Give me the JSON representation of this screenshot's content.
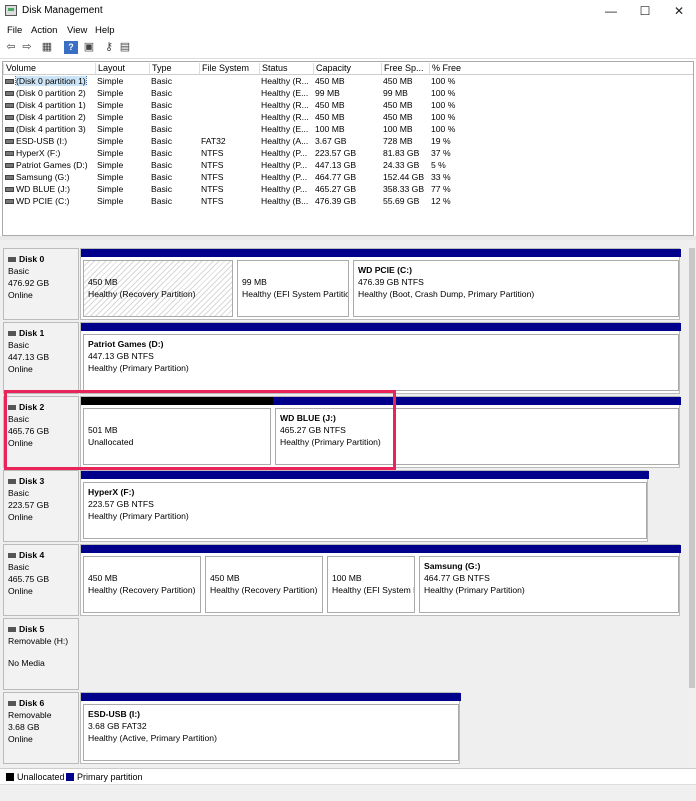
{
  "window": {
    "title": "Disk Management",
    "minimize": "—",
    "maximize": "☐",
    "close": "✕"
  },
  "menu": [
    "File",
    "Action",
    "View",
    "Help"
  ],
  "toolbar_icons": [
    "back-arrow-icon",
    "forward-arrow-icon",
    "properties-icon",
    "help-icon",
    "settings-icon",
    "console-icon"
  ],
  "volume_table": {
    "headers": [
      "Volume",
      "Layout",
      "Type",
      "File System",
      "Status",
      "Capacity",
      "Free Sp...",
      "% Free"
    ],
    "rows": [
      [
        "(Disk 0 partition 1)",
        "Simple",
        "Basic",
        "",
        "Healthy (R...",
        "450 MB",
        "450 MB",
        "100 %"
      ],
      [
        "(Disk 0 partition 2)",
        "Simple",
        "Basic",
        "",
        "Healthy (E...",
        "99 MB",
        "99 MB",
        "100 %"
      ],
      [
        "(Disk 4 partition 1)",
        "Simple",
        "Basic",
        "",
        "Healthy (R...",
        "450 MB",
        "450 MB",
        "100 %"
      ],
      [
        "(Disk 4 partition 2)",
        "Simple",
        "Basic",
        "",
        "Healthy (R...",
        "450 MB",
        "450 MB",
        "100 %"
      ],
      [
        "(Disk 4 partition 3)",
        "Simple",
        "Basic",
        "",
        "Healthy (E...",
        "100 MB",
        "100 MB",
        "100 %"
      ],
      [
        "ESD-USB (I:)",
        "Simple",
        "Basic",
        "FAT32",
        "Healthy (A...",
        "3.67 GB",
        "728 MB",
        "19 %"
      ],
      [
        "HyperX (F:)",
        "Simple",
        "Basic",
        "NTFS",
        "Healthy (P...",
        "223.57 GB",
        "81.83 GB",
        "37 %"
      ],
      [
        "Patriot Games (D:)",
        "Simple",
        "Basic",
        "NTFS",
        "Healthy (P...",
        "447.13 GB",
        "24.33 GB",
        "5 %"
      ],
      [
        "Samsung (G:)",
        "Simple",
        "Basic",
        "NTFS",
        "Healthy (P...",
        "464.77 GB",
        "152.44 GB",
        "33 %"
      ],
      [
        "WD BLUE (J:)",
        "Simple",
        "Basic",
        "NTFS",
        "Healthy (P...",
        "465.27 GB",
        "358.33 GB",
        "77 %"
      ],
      [
        "WD PCIE (C:)",
        "Simple",
        "Basic",
        "NTFS",
        "Healthy (B...",
        "476.39 GB",
        "55.69 GB",
        "12 %"
      ]
    ]
  },
  "disks": [
    {
      "name": "Disk 0",
      "type": "Basic",
      "size": "476.92 GB",
      "status": "Online",
      "partitions": [
        {
          "name": "",
          "size": "450 MB",
          "status": "Healthy (Recovery Partition)",
          "kind": "primary",
          "hatched": true
        },
        {
          "name": "",
          "size": "99 MB",
          "status": "Healthy (EFI System Partitio",
          "kind": "primary"
        },
        {
          "name": "WD PCIE  (C:)",
          "size": "476.39 GB NTFS",
          "status": "Healthy (Boot, Crash Dump, Primary Partition)",
          "kind": "primary"
        }
      ]
    },
    {
      "name": "Disk 1",
      "type": "Basic",
      "size": "447.13 GB",
      "status": "Online",
      "partitions": [
        {
          "name": "Patriot Games  (D:)",
          "size": "447.13 GB NTFS",
          "status": "Healthy (Primary Partition)",
          "kind": "primary"
        }
      ]
    },
    {
      "name": "Disk 2",
      "type": "Basic",
      "size": "465.76 GB",
      "status": "Online",
      "partitions": [
        {
          "name": "",
          "size": "501 MB",
          "status": "Unallocated",
          "kind": "unallocated"
        },
        {
          "name": "WD BLUE  (J:)",
          "size": "465.27 GB NTFS",
          "status": "Healthy (Primary Partition)",
          "kind": "primary"
        }
      ]
    },
    {
      "name": "Disk 3",
      "type": "Basic",
      "size": "223.57 GB",
      "status": "Online",
      "partitions": [
        {
          "name": "HyperX  (F:)",
          "size": "223.57 GB NTFS",
          "status": "Healthy (Primary Partition)",
          "kind": "primary"
        }
      ]
    },
    {
      "name": "Disk 4",
      "type": "Basic",
      "size": "465.75 GB",
      "status": "Online",
      "partitions": [
        {
          "name": "",
          "size": "450 MB",
          "status": "Healthy (Recovery Partition)",
          "kind": "primary"
        },
        {
          "name": "",
          "size": "450 MB",
          "status": "Healthy (Recovery Partition)",
          "kind": "primary"
        },
        {
          "name": "",
          "size": "100 MB",
          "status": "Healthy (EFI System P",
          "kind": "primary"
        },
        {
          "name": "Samsung  (G:)",
          "size": "464.77 GB NTFS",
          "status": "Healthy (Primary Partition)",
          "kind": "primary"
        }
      ]
    },
    {
      "name": "Disk 5",
      "type": "Removable (H:)",
      "size": "",
      "status": "No Media",
      "partitions": []
    },
    {
      "name": "Disk 6",
      "type": "Removable",
      "size": "3.68 GB",
      "status": "Online",
      "partitions": [
        {
          "name": "ESD-USB  (I:)",
          "size": "3.68 GB FAT32",
          "status": "Healthy (Active, Primary Partition)",
          "kind": "primary"
        }
      ]
    }
  ],
  "legend": {
    "unallocated": "Unallocated",
    "primary": "Primary partition"
  },
  "colors": {
    "primary": "#00008b",
    "unallocated": "#000000",
    "highlight": "#e8245a"
  }
}
